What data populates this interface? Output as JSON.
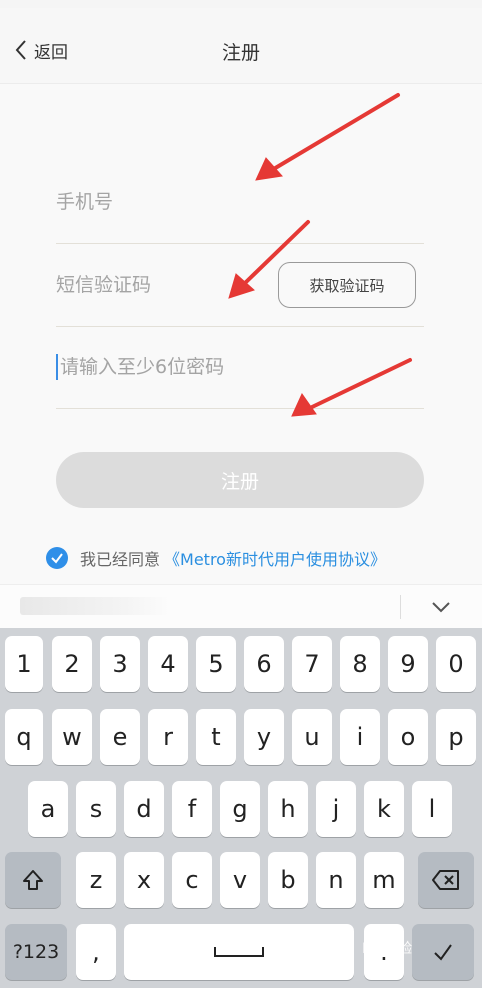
{
  "nav": {
    "back_label": "返回",
    "title": "注册"
  },
  "form": {
    "phone_placeholder": "手机号",
    "sms_placeholder": "短信验证码",
    "password_placeholder": "请输入至少6位密码",
    "get_code_label": "获取验证码",
    "register_label": "注册",
    "agree_text": "我已经同意",
    "agree_link": "《Metro新时代用户使用协议》"
  },
  "keyboard": {
    "numbers": [
      "1",
      "2",
      "3",
      "4",
      "5",
      "6",
      "7",
      "8",
      "9",
      "0"
    ],
    "row1": [
      "q",
      "w",
      "e",
      "r",
      "t",
      "y",
      "u",
      "i",
      "o",
      "p"
    ],
    "row2": [
      "a",
      "s",
      "d",
      "f",
      "g",
      "h",
      "j",
      "k",
      "l"
    ],
    "row3": [
      "z",
      "x",
      "c",
      "v",
      "b",
      "n",
      "m"
    ],
    "symbols_label": "?123",
    "comma": ",",
    "period": "."
  },
  "watermark": "Bai经验",
  "colors": {
    "accent": "#2f8fe8",
    "annotation_arrow": "#e53935",
    "disabled_button": "#dcdcdc"
  }
}
